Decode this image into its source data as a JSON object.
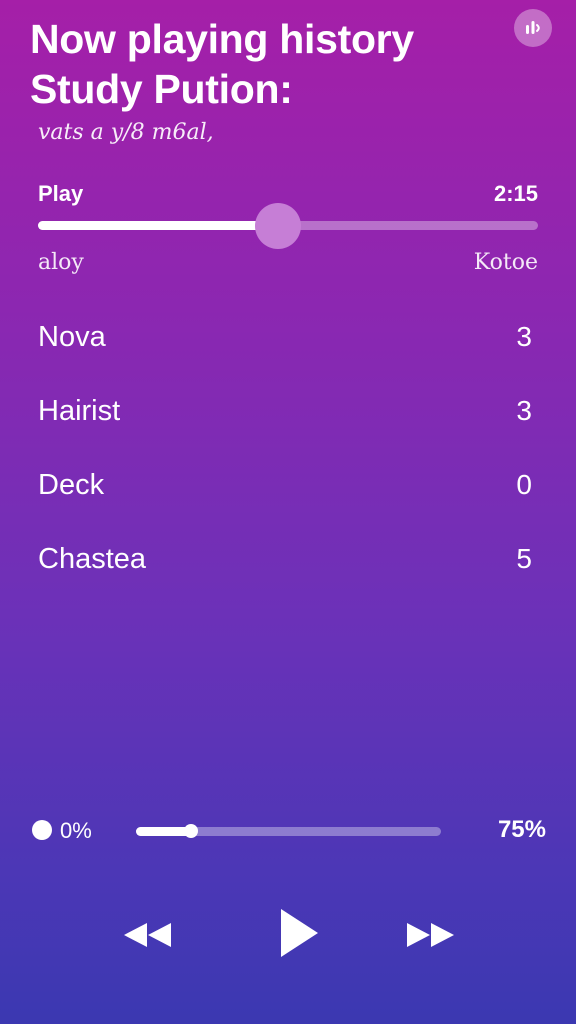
{
  "header": {
    "title_line1": "Now playing history",
    "title_line2": "Study Pution:",
    "subtitle": "vats a y/8 m6al,",
    "icon": "equalizer-icon"
  },
  "player": {
    "play_label": "Play",
    "time": "2:15",
    "progress_fraction": 0.48,
    "range_left": "aloy",
    "range_right": "Kotoe"
  },
  "history": [
    {
      "name": "Nova",
      "count": "3"
    },
    {
      "name": "Hairist",
      "count": "3"
    },
    {
      "name": "Deck",
      "count": "0"
    },
    {
      "name": "Chastea",
      "count": "5"
    }
  ],
  "volume": {
    "min_label": "0%",
    "max_label": "75%",
    "level_fraction": 0.18
  },
  "controls": {
    "rewind_icon": "rewind-icon",
    "play_icon": "play-icon",
    "forward_icon": "fast-forward-icon"
  },
  "colors": {
    "gradient_top": "#a51fa8",
    "gradient_bottom": "#3b38b1",
    "accent_thumb": "#c67ed6"
  }
}
